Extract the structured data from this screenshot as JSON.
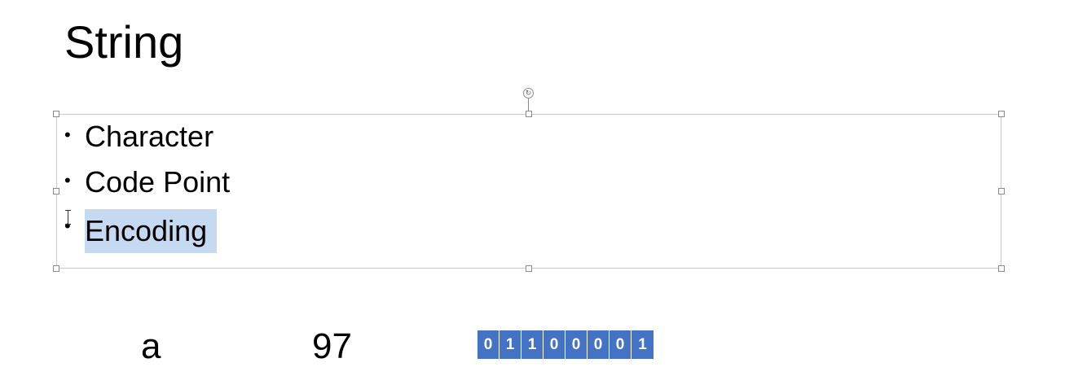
{
  "slide": {
    "title": "String",
    "bullets": [
      {
        "text": "Character",
        "selected": false
      },
      {
        "text": "Code Point",
        "selected": false
      },
      {
        "text": "Encoding",
        "selected": true
      }
    ],
    "bullet_symbol": "•",
    "example": {
      "character": "a",
      "code_point": "97",
      "bits": [
        "0",
        "1",
        "1",
        "0",
        "0",
        "0",
        "0",
        "1"
      ]
    }
  },
  "colors": {
    "bit_fill": "#4472c4",
    "selection_highlight": "#c5d9f1",
    "frame": "#c8c8c8"
  },
  "icons": {
    "rotate_handle": "rotate-icon",
    "cursor": "text-cursor-icon"
  }
}
